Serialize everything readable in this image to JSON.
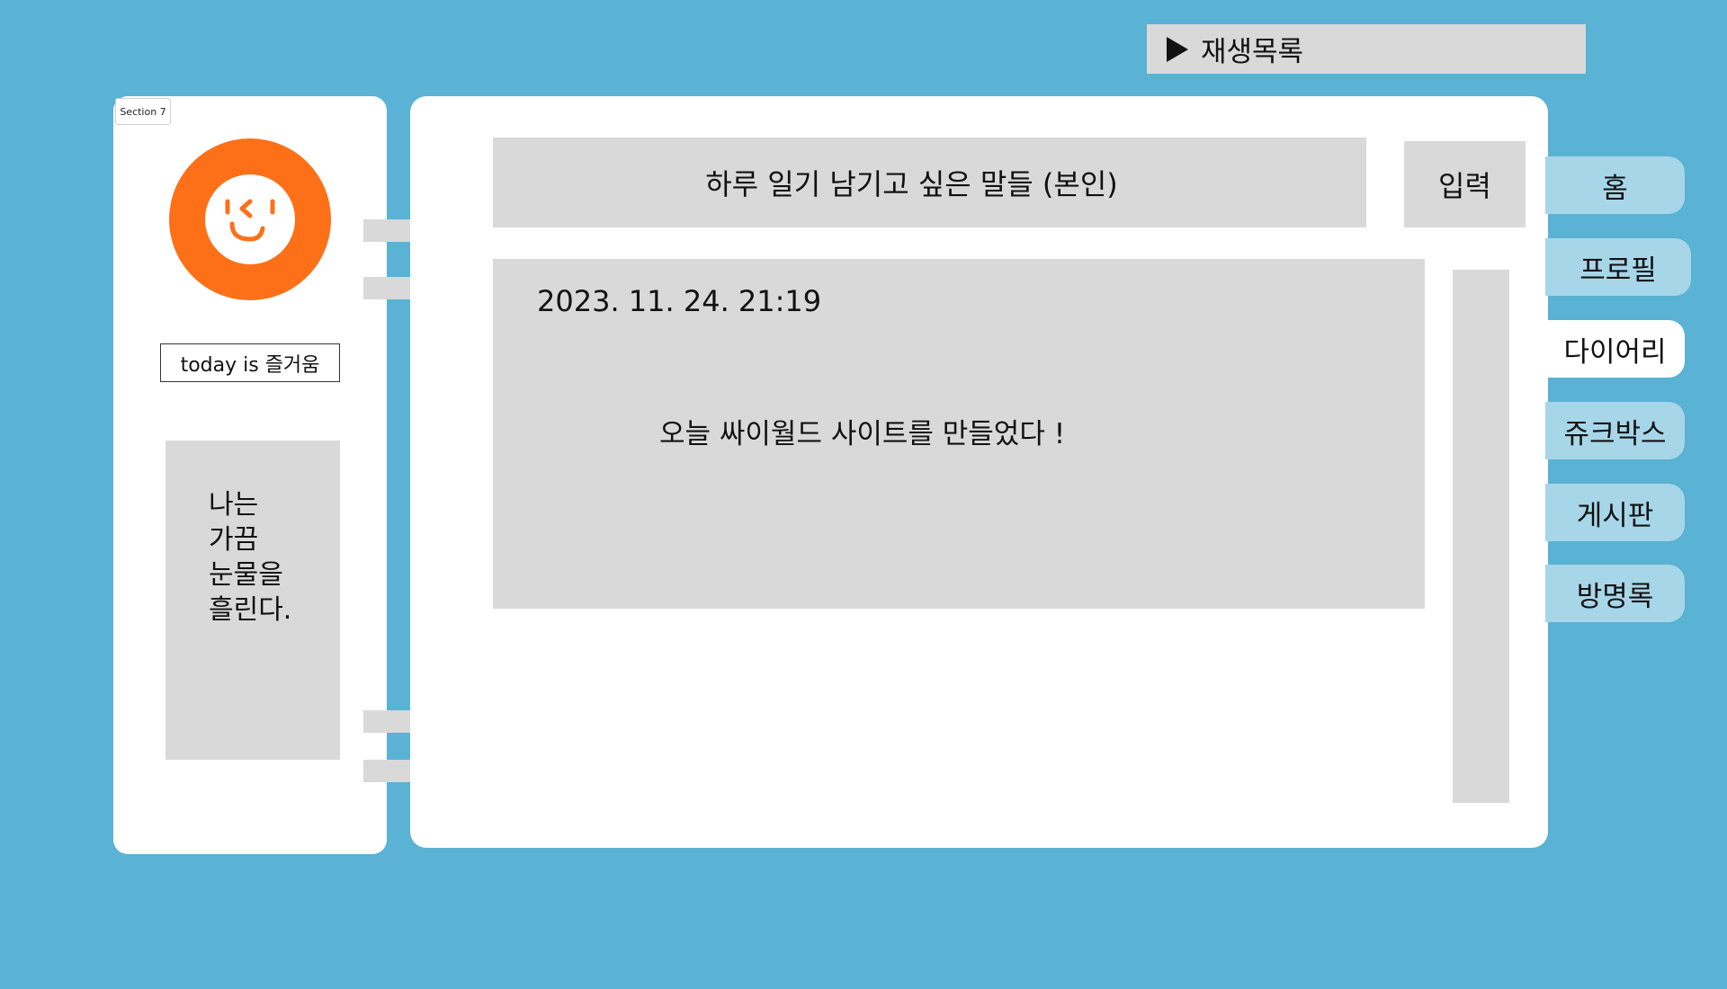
{
  "playlist": {
    "label": "재생목록"
  },
  "profile": {
    "section_label": "Section 7",
    "today": "today is 즐거움",
    "quote_lines": [
      "나는",
      "가끔",
      "눈물을",
      "흘린다."
    ]
  },
  "diary": {
    "title": "하루 일기 남기고 싶은 말들 (본인)",
    "input_button": "입력",
    "entry": {
      "date": "2023. 11. 24. 21:19",
      "text": "오늘 싸이월드 사이트를 만들었다 !"
    }
  },
  "nav": {
    "items": [
      {
        "label": "홈"
      },
      {
        "label": "프로필"
      },
      {
        "label": "다이어리"
      },
      {
        "label": "쥬크박스"
      },
      {
        "label": "게시판"
      },
      {
        "label": "방명록"
      }
    ],
    "active": "다이어리"
  },
  "colors": {
    "background": "#5ab2d5",
    "panel": "#d9d9d9",
    "avatar": "#fd7018",
    "tab": "#a7d6e9",
    "tab_active": "#ffffff"
  }
}
